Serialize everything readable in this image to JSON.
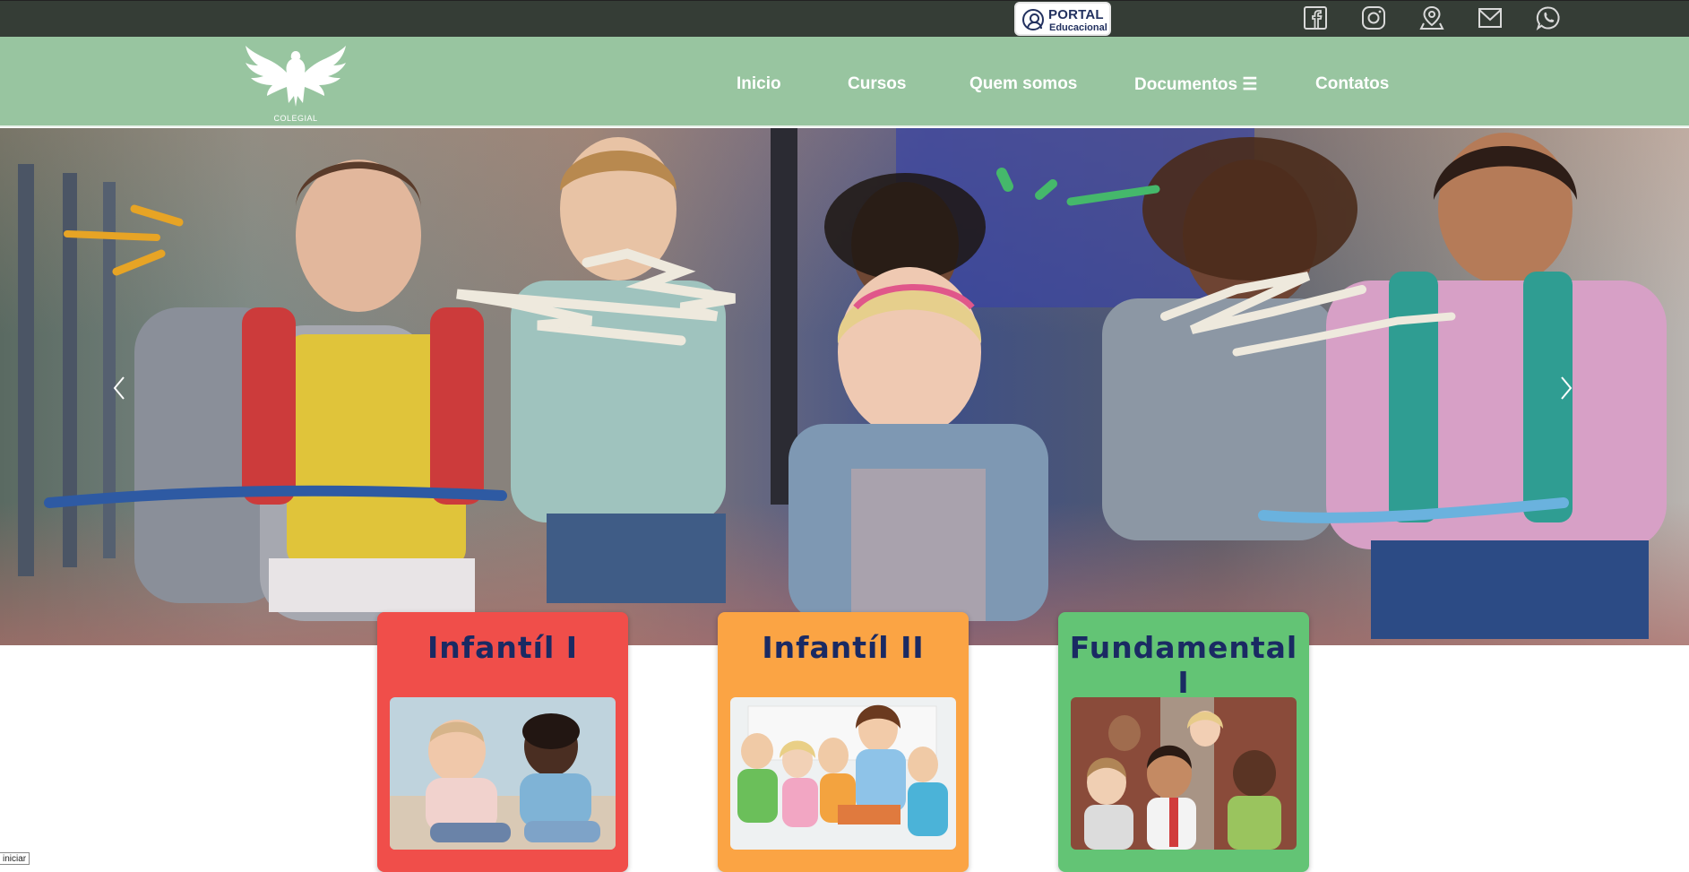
{
  "topbar": {
    "portal": {
      "line1": "PORTAL",
      "line2": "Educacional"
    },
    "social_icons": [
      "facebook-icon",
      "instagram-icon",
      "map-pin-icon",
      "mail-icon",
      "whatsapp-icon"
    ]
  },
  "header": {
    "logo_caption": "COLEGIAL",
    "nav": [
      {
        "label": "Inicio"
      },
      {
        "label": "Cursos"
      },
      {
        "label": "Quem somos"
      },
      {
        "label": "Documentos ☰"
      },
      {
        "label": "Contatos"
      }
    ]
  },
  "hero": {
    "prev_icon": "chevron-left-icon",
    "next_icon": "chevron-right-icon"
  },
  "cards": [
    {
      "title": "Infantíl I",
      "color": "#f04e4a"
    },
    {
      "title": "Infantíl II",
      "color": "#fba444"
    },
    {
      "title": "Fundamental I",
      "color": "#63c475"
    }
  ],
  "footer_tag": "iniciar",
  "colors": {
    "topbar": "#353d36",
    "navbar": "#98c5a0",
    "card_title": "#1a2a63"
  }
}
